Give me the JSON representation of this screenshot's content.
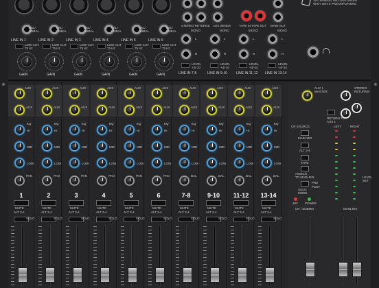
{
  "brand": {
    "text": "16-CHANNEL MIC/LINE MIXER\nWITH ONYX PREAMPLIFIERS"
  },
  "inputs": [
    {
      "line_label": "LINE IN 1",
      "gain_label": "GAIN",
      "bal": "BAL/\nUNBAL",
      "lowcut": "LOW CUT\n75 Hz"
    },
    {
      "line_label": "LINE IN 2",
      "gain_label": "GAIN",
      "bal": "BAL/\nUNBAL",
      "lowcut": "LOW CUT\n75 Hz"
    },
    {
      "line_label": "LINE IN 3",
      "gain_label": "GAIN",
      "bal": "BAL/\nUNBAL",
      "lowcut": "LOW CUT\n75 Hz"
    },
    {
      "line_label": "LINE IN 4",
      "gain_label": "GAIN",
      "bal": "BAL/\nUNBAL",
      "lowcut": "LOW CUT\n75 Hz"
    },
    {
      "line_label": "LINE IN 5",
      "gain_label": "GAIN",
      "bal": "BAL/\nUNBAL",
      "lowcut": "LOW CUT\n75 Hz"
    },
    {
      "line_label": "LINE IN 6",
      "gain_label": "GAIN",
      "bal": "BAL/\nUNBAL",
      "lowcut": "LOW CUT\n75 Hz"
    }
  ],
  "stereo_inputs": [
    {
      "label": "LINE IN 7-8",
      "mono": "MONO",
      "l": "L",
      "r": "R",
      "level": "LEVEL\n+4/-10"
    },
    {
      "label": "LINE IN 9-10",
      "mono": "MONO",
      "l": "L",
      "r": "R",
      "level": "LEVEL\n+4/-10"
    },
    {
      "label": "LINE IN 11-12",
      "mono": "MONO",
      "l": "L",
      "r": "R",
      "level": "LEVEL\n+4/-10"
    },
    {
      "label": "LINE IN 13-14",
      "mono": "MONO",
      "l": "L",
      "r": "R",
      "level": "LEVEL\n+4/-10"
    }
  ],
  "top_labels": {
    "stereo_returns": "STEREO RETURNS",
    "aux_sends": "AUX SENDS",
    "tape_in": "TAPE IN",
    "tape_out": "TAPE OUT",
    "main_out": "MAIN OUT"
  },
  "channels": [
    {
      "num": "1",
      "mute": "MUTE",
      "alt": "ALT 3-4",
      "solo": "SOLO",
      "aux1": "AUX",
      "aux2": "AUX",
      "eq": "EQ",
      "hi": "HI",
      "mid": "MID",
      "low": "LOW",
      "pan": "PAN"
    },
    {
      "num": "2",
      "mute": "MUTE",
      "alt": "ALT 3-4",
      "solo": "SOLO",
      "aux1": "AUX",
      "aux2": "AUX",
      "eq": "EQ",
      "hi": "HI",
      "mid": "MID",
      "low": "LOW",
      "pan": "PAN"
    },
    {
      "num": "3",
      "mute": "MUTE",
      "alt": "ALT 3-4",
      "solo": "SOLO",
      "aux1": "AUX",
      "aux2": "AUX",
      "eq": "EQ",
      "hi": "HI",
      "mid": "MID",
      "low": "LOW",
      "pan": "PAN"
    },
    {
      "num": "4",
      "mute": "MUTE",
      "alt": "ALT 3-4",
      "solo": "SOLO",
      "aux1": "AUX",
      "aux2": "AUX",
      "eq": "EQ",
      "hi": "HI",
      "mid": "MID",
      "low": "LOW",
      "pan": "PAN"
    },
    {
      "num": "5",
      "mute": "MUTE",
      "alt": "ALT 3-4",
      "solo": "SOLO",
      "aux1": "AUX",
      "aux2": "AUX",
      "eq": "EQ",
      "hi": "HI",
      "mid": "MID",
      "low": "LOW",
      "pan": "PAN"
    },
    {
      "num": "6",
      "mute": "MUTE",
      "alt": "ALT 3-4",
      "solo": "SOLO",
      "aux1": "AUX",
      "aux2": "AUX",
      "eq": "EQ",
      "hi": "HI",
      "mid": "MID",
      "low": "LOW",
      "pan": "PAN"
    },
    {
      "num": "7-8",
      "mute": "MUTE",
      "alt": "ALT 3-4",
      "solo": "SOLO",
      "aux1": "AUX",
      "aux2": "AUX",
      "eq": "EQ",
      "hi": "HI",
      "mid": "MID",
      "low": "LOW",
      "pan": "BAL"
    },
    {
      "num": "9-10",
      "mute": "MUTE",
      "alt": "ALT 3-4",
      "solo": "SOLO",
      "aux1": "AUX",
      "aux2": "AUX",
      "eq": "EQ",
      "hi": "HI",
      "mid": "MID",
      "low": "LOW",
      "pan": "BAL"
    },
    {
      "num": "11-12",
      "mute": "MUTE",
      "alt": "ALT 3-4",
      "solo": "SOLO",
      "aux1": "AUX",
      "aux2": "AUX",
      "eq": "EQ",
      "hi": "HI",
      "mid": "MID",
      "low": "LOW",
      "pan": "BAL"
    },
    {
      "num": "13-14",
      "mute": "MUTE",
      "alt": "ALT 3-4",
      "solo": "SOLO",
      "aux1": "AUX",
      "aux2": "AUX",
      "eq": "EQ",
      "hi": "HI",
      "mid": "MID",
      "low": "LOW",
      "pan": "BAL"
    }
  ],
  "master": {
    "aux1_master": "AUX 1\nMASTER",
    "stereo_returns": "STEREO\nRETURNS",
    "return_to_aux1": "RETURN TO\nAUX 1",
    "cr_source": "CR SOURCE",
    "main_mix": "MAIN MIX",
    "alt34": "ALT 3-4",
    "tape": "TAPE",
    "assign": "ASSIGN\nTO MAIN MIX",
    "solo_mode": "SOLO\nMODE",
    "48v": "48V",
    "power": "POWER",
    "left": "LEFT",
    "right": "RIGHT",
    "level_set": "LEVEL\nSET",
    "cr_submix": "CR / SUBMIX",
    "main_mix_fader": "MAIN MIX",
    "phones": "PHONES",
    "pre": "PRE",
    "post": "POST"
  },
  "colors": {
    "panel": "#262628",
    "aux_yellow": "#d7d63a",
    "eq_blue": "#4aa3e0",
    "red_jack": "#d9383a",
    "led_green": "#3bbf4a",
    "led_yellow": "#e0c93a",
    "led_red": "#e03a3a"
  }
}
